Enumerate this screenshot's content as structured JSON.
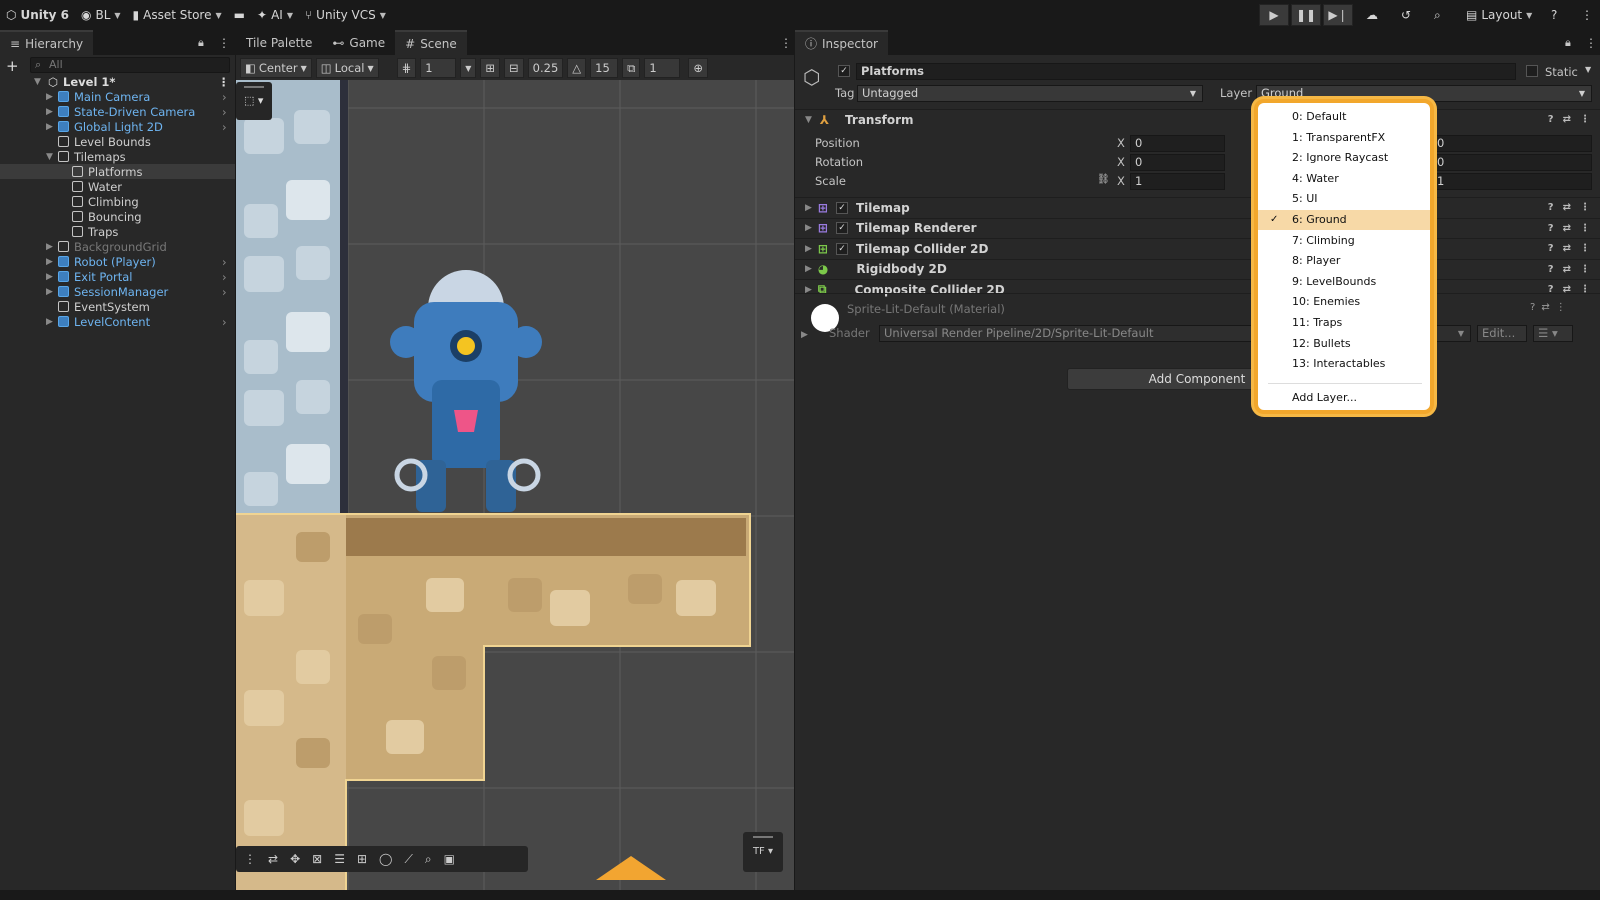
{
  "toolbar": {
    "app": "Unity 6",
    "account": "BL",
    "asset_store": "Asset Store",
    "ai": "AI",
    "vcs": "Unity VCS",
    "layout": "Layout"
  },
  "hierarchy": {
    "tab": "Hierarchy",
    "search_placeholder": "All",
    "scene": "Level 1*",
    "items": [
      {
        "label": "Main Camera",
        "indent": 1,
        "blue": true
      },
      {
        "label": "State-Driven Camera",
        "indent": 1,
        "blue": true
      },
      {
        "label": "Global Light 2D",
        "indent": 1,
        "blue": true
      },
      {
        "label": "Level Bounds",
        "indent": 1,
        "blue": false
      },
      {
        "label": "Tilemaps",
        "indent": 1,
        "blue": false
      },
      {
        "label": "Platforms",
        "indent": 2,
        "blue": false
      },
      {
        "label": "Water",
        "indent": 2,
        "blue": false
      },
      {
        "label": "Climbing",
        "indent": 2,
        "blue": false
      },
      {
        "label": "Bouncing",
        "indent": 2,
        "blue": false
      },
      {
        "label": "Traps",
        "indent": 2,
        "blue": false
      },
      {
        "label": "BackgroundGrid",
        "indent": 1,
        "blue": false
      },
      {
        "label": "Robot (Player)",
        "indent": 1,
        "blue": true
      },
      {
        "label": "Exit Portal",
        "indent": 1,
        "blue": true
      },
      {
        "label": "SessionManager",
        "indent": 1,
        "blue": true
      },
      {
        "label": "EventSystem",
        "indent": 1,
        "blue": false
      },
      {
        "label": "LevelContent",
        "indent": 1,
        "blue": true
      }
    ]
  },
  "center_tabs": {
    "tile_palette": "Tile Palette",
    "game": "Game",
    "scene": "Scene"
  },
  "scene_toolbar": {
    "pivot": "Center",
    "space": "Local",
    "grid_value": "1",
    "snap_value": "0.25",
    "rotate_snap": "15",
    "scale_snap": "1",
    "overlay_label": "TF"
  },
  "inspector": {
    "tab": "Inspector",
    "object_name": "Platforms",
    "static_label": "Static",
    "tag_label": "Tag",
    "tag_value": "Untagged",
    "layer_label": "Layer",
    "layer_value": "Ground",
    "transform": {
      "title": "Transform",
      "rows": [
        {
          "label": "Position",
          "x": "0",
          "z": "0"
        },
        {
          "label": "Rotation",
          "x": "0",
          "z": "0"
        },
        {
          "label": "Scale",
          "x": "1",
          "z": "1"
        }
      ]
    },
    "components": [
      "Tilemap",
      "Tilemap Renderer",
      "Tilemap Collider 2D",
      "Rigidbody 2D",
      "Composite Collider 2D"
    ],
    "material_name": "Sprite-Lit-Default (Material)",
    "shader_label": "Shader",
    "shader_value": "Universal Render Pipeline/2D/Sprite-Lit-Default",
    "edit_label": "Edit...",
    "add_component": "Add Component"
  },
  "layer_dropdown": {
    "items": [
      "0: Default",
      "1: TransparentFX",
      "2: Ignore Raycast",
      "4: Water",
      "5: UI",
      "6: Ground",
      "7: Climbing",
      "8: Player",
      "9: LevelBounds",
      "10: Enemies",
      "11: Traps",
      "12: Bullets",
      "13: Interactables"
    ],
    "selected_index": 5,
    "add_layer": "Add Layer..."
  }
}
